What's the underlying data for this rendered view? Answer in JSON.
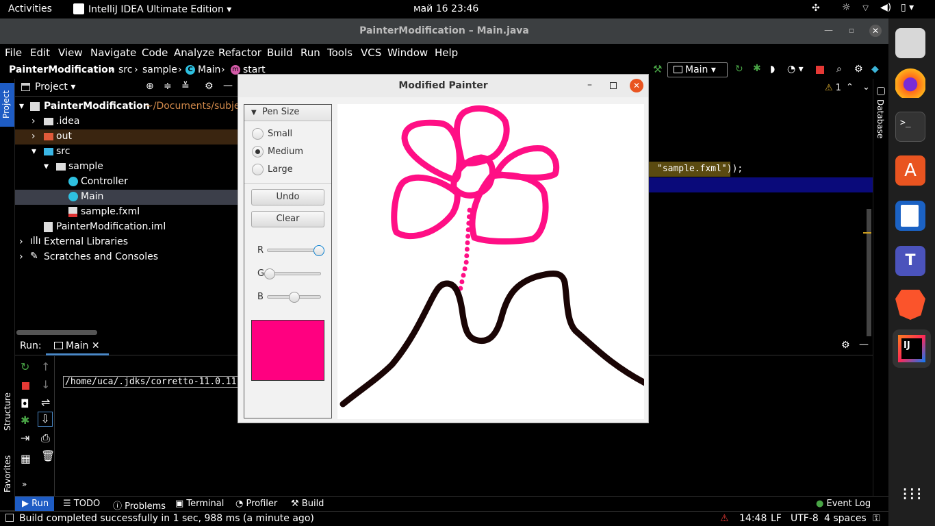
{
  "topbar": {
    "activities": "Activities",
    "app": "IntelliJ IDEA Ultimate Edition",
    "clock": "май 16  23:46"
  },
  "window": {
    "title": "PainterModification – Main.java"
  },
  "menu": [
    "File",
    "Edit",
    "View",
    "Navigate",
    "Code",
    "Analyze",
    "Refactor",
    "Build",
    "Run",
    "Tools",
    "VCS",
    "Window",
    "Help"
  ],
  "nav": {
    "crumbs": [
      "PainterModification",
      "src",
      "sample",
      "Main",
      "start"
    ],
    "run_config": "Main"
  },
  "project": {
    "header": "Project",
    "root": "PainterModification",
    "root_path": "~/Documents/subje",
    "items": [
      ".idea",
      "out",
      "src",
      "sample",
      "Controller",
      "Main",
      "sample.fxml",
      "PainterModification.iml",
      "External Libraries",
      "Scratches and Consoles"
    ]
  },
  "editor": {
    "code_snippet": "\"sample.fxml\"));",
    "warnings": "1"
  },
  "right_strip": {
    "database": "Database"
  },
  "left_strip": {
    "project": "Project",
    "structure": "Structure",
    "favorites": "Favorites"
  },
  "run": {
    "label": "Run:",
    "tab": "Main",
    "output": "/home/uca/.jdks/corretto-11.0.11"
  },
  "bottom_tabs": [
    "Run",
    "TODO",
    "Problems",
    "Terminal",
    "Profiler",
    "Build"
  ],
  "event_log": "Event Log",
  "status": {
    "message": "Build completed successfully in 1 sec, 988 ms (a minute ago)",
    "position": "14:48",
    "line_sep": "LF",
    "encoding": "UTF-8",
    "indent": "4 spaces"
  },
  "painter": {
    "title": "Modified Painter",
    "pen_size_header": "Pen Size",
    "pen_sizes": [
      "Small",
      "Medium",
      "Large"
    ],
    "selected_pen": "Medium",
    "undo": "Undo",
    "clear": "Clear",
    "sliders": [
      {
        "label": "R",
        "value": 1.0
      },
      {
        "label": "G",
        "value": 0.0
      },
      {
        "label": "B",
        "value": 0.5
      }
    ],
    "color_preview": "#ff0080",
    "pink": "#ff0f85",
    "brown": "#1a0505"
  }
}
